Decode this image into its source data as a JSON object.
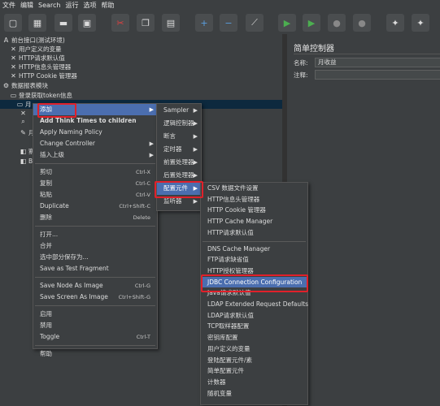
{
  "menubar": [
    "文件",
    "编辑",
    "Search",
    "运行",
    "选项",
    "帮助"
  ],
  "toolbar": {
    "colors": {
      "bg": "#3c3f41",
      "button": "#4a4d4f"
    },
    "icons": [
      "new-icon",
      "templates-icon",
      "open-icon",
      "save-icon",
      "cut-icon",
      "copy-icon",
      "paste-icon",
      "expand-icon",
      "collapse-icon",
      "toggle-icon",
      "start-icon",
      "start-no-pause-icon",
      "stop-icon",
      "shutdown-icon",
      "clear-icon",
      "clear-all-icon"
    ]
  },
  "tree": [
    {
      "label": "前台接口(测试环境)",
      "icon": "A"
    },
    {
      "label": "用户定义的变量",
      "icon": "✕"
    },
    {
      "label": "HTTP请求默认值",
      "icon": "✕"
    },
    {
      "label": "HTTP信息头管理器",
      "icon": "✕"
    },
    {
      "label": "HTTP Cookie 管理器",
      "icon": "✕"
    },
    {
      "label": "数据报表模块",
      "icon": "⚙"
    },
    {
      "label": "登录获取token信息",
      "icon": "▭"
    },
    {
      "label": "月",
      "icon": "▭"
    },
    {
      "label": "",
      "icon": "✕"
    },
    {
      "label": "",
      "icon": "⌕"
    },
    {
      "label": "月",
      "icon": "✎"
    },
    {
      "label": "察看",
      "icon": "◧"
    },
    {
      "label": "Bea",
      "icon": "◧"
    }
  ],
  "right_panel": {
    "title": "简单控制器",
    "name_label": "名称:",
    "name_value": "月收益",
    "comment_label": "注释:",
    "comment_value": ""
  },
  "context_menu": {
    "items": [
      {
        "label": "添加",
        "submenu": true,
        "highlighted": true
      },
      {
        "label": "Add Think Times to children",
        "bold": true
      },
      {
        "label": "Apply Naming Policy"
      },
      {
        "label": "Change Controller",
        "submenu": true
      },
      {
        "label": "插入上级",
        "submenu": true
      },
      {
        "separator": true
      },
      {
        "label": "剪切",
        "shortcut": "Ctrl-X"
      },
      {
        "label": "复制",
        "shortcut": "Ctrl-C"
      },
      {
        "label": "粘贴",
        "shortcut": "Ctrl-V"
      },
      {
        "label": "Duplicate",
        "shortcut": "Ctrl+Shift-C"
      },
      {
        "label": "删除",
        "shortcut": "Delete"
      },
      {
        "separator": true
      },
      {
        "label": "打开..."
      },
      {
        "label": "合并"
      },
      {
        "label": "选中部分保存为..."
      },
      {
        "label": "Save as Test Fragment"
      },
      {
        "separator": true
      },
      {
        "label": "Save Node As Image",
        "shortcut": "Ctrl-G"
      },
      {
        "label": "Save Screen As Image",
        "shortcut": "Ctrl+Shift-G"
      },
      {
        "separator": true
      },
      {
        "label": "启用"
      },
      {
        "label": "禁用"
      },
      {
        "label": "Toggle",
        "shortcut": "Ctrl-T"
      },
      {
        "separator": true
      },
      {
        "label": "帮助"
      }
    ]
  },
  "add_submenu": {
    "items": [
      {
        "label": "Sampler"
      },
      {
        "label": "逻辑控制器"
      },
      {
        "label": "断言"
      },
      {
        "label": "定时器"
      },
      {
        "label": "前置处理器"
      },
      {
        "label": "后置处理器"
      },
      {
        "label": "配置元件",
        "highlighted": true
      },
      {
        "label": "监听器"
      }
    ]
  },
  "config_submenu": {
    "items": [
      {
        "label": "CSV 数据文件设置"
      },
      {
        "label": "HTTP信息头管理器"
      },
      {
        "label": "HTTP Cookie 管理器"
      },
      {
        "label": "HTTP Cache Manager"
      },
      {
        "label": "HTTP请求默认值"
      },
      {
        "separator": true
      },
      {
        "label": "DNS Cache Manager"
      },
      {
        "label": "FTP请求缺省值"
      },
      {
        "label": "HTTP授权管理器"
      },
      {
        "label": "JDBC Connection Configuration",
        "highlighted": true
      },
      {
        "label": "Java请求默认值"
      },
      {
        "label": "LDAP Extended Request Defaults"
      },
      {
        "label": "LDAP请求默认值"
      },
      {
        "label": "TCP取样器配置"
      },
      {
        "label": "密钥库配置"
      },
      {
        "label": "用户定义的变量"
      },
      {
        "label": "登陆配置元件/素"
      },
      {
        "label": "简单配置元件"
      },
      {
        "label": "计数器"
      },
      {
        "label": "随机变量"
      }
    ]
  },
  "colors": {
    "highlight": "#4b6eaf",
    "annotation_red": "#e0202a",
    "selected_row": "#0d293e"
  }
}
